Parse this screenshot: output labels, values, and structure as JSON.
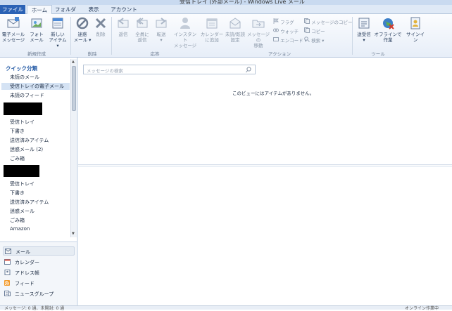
{
  "window": {
    "title": "受信トレイ (外部メール) - Windows Live メール"
  },
  "tabs": [
    "ファイル",
    "ホーム",
    "フォルダー",
    "表示",
    "アカウント"
  ],
  "ribbon": {
    "new": {
      "new_email": "電子メール\nメッセージ",
      "new_photo": "フォト\nメール",
      "new_item": "新しい\nアイテム ▾",
      "group": "新規作成"
    },
    "delete": {
      "junk": "迷惑\nメール ▾",
      "delete": "削除",
      "group": "削除"
    },
    "respond": {
      "reply": "返信",
      "reply_all": "全員に\n返信",
      "forward": "転送\n▾",
      "instant": "インスタント\nメッセージ",
      "calendar_add": "カレンダー\nに追加",
      "mark_read": "未読/既読\n設定",
      "move": "メッセージの\n移動",
      "group": "応答"
    },
    "actions": {
      "flag": "フラグ",
      "watch": "ウォッチ",
      "encode": "エンコード ▾",
      "copy_to": "メッセージのコピー",
      "copy": "コピー",
      "find": "検索 ▾",
      "group": "アクション"
    },
    "tools": {
      "send_receive": "送受信\n▾",
      "offline": "オフラインで\n作業",
      "signin": "サインイン",
      "group": "ツール"
    }
  },
  "sidebar": {
    "quick_views": "クイック分類",
    "quick_items": [
      "未読のメール",
      "受信トレイの電子メール",
      "未読のフィード"
    ],
    "account1_items": [
      "受信トレイ",
      "下書き",
      "送信済みアイテム",
      "迷惑メール (2)",
      "ごみ箱"
    ],
    "account2_items": [
      "受信トレイ",
      "下書き",
      "送信済みアイテム",
      "迷惑メール",
      "ごみ箱",
      "Amazon"
    ]
  },
  "nav": [
    "メール",
    "カレンダー",
    "アドレス帳",
    "フィード",
    "ニュースグループ"
  ],
  "search": {
    "placeholder": "メッセージの検索"
  },
  "message_list": {
    "empty_text": "このビューにはアイテムがありません。"
  },
  "status": {
    "left": "メッセージ: 0 通、未開封: 0 通",
    "right": "オンライン作業中"
  },
  "colors": {
    "file_tab": "#2b62b5",
    "quick_header": "#2a5fa8"
  }
}
